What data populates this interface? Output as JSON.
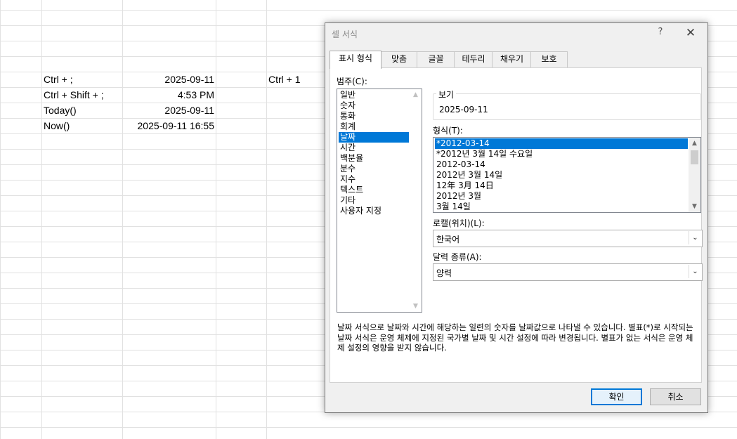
{
  "sheet": {
    "rows": [
      {
        "a": "Ctrl + ;",
        "b": "2025-09-11",
        "c": "Ctrl + 1"
      },
      {
        "a": "Ctrl + Shift + ;",
        "b": "4:53 PM",
        "c": ""
      },
      {
        "a": "Today()",
        "b": "2025-09-11",
        "c": ""
      },
      {
        "a": "Now()",
        "b": "2025-09-11 16:55",
        "c": ""
      }
    ]
  },
  "dialog": {
    "title": "셀 서식",
    "help": "?",
    "close": "✕",
    "tabs": [
      "표시 형식",
      "맞춤",
      "글꼴",
      "테두리",
      "채우기",
      "보호"
    ],
    "category_label": "범주(C):",
    "categories": [
      "일반",
      "숫자",
      "통화",
      "회계",
      "날짜",
      "시간",
      "백분율",
      "분수",
      "지수",
      "텍스트",
      "기타",
      "사용자 지정"
    ],
    "selected_category": "날짜",
    "sample_label": "보기",
    "sample_value": "2025-09-11",
    "type_label": "형식(T):",
    "types": [
      "*2012-03-14",
      "*2012년 3월 14일 수요일",
      "2012-03-14",
      "2012년 3월 14일",
      "12年 3月 14日",
      "2012년 3월",
      "3월 14일"
    ],
    "selected_type": "*2012-03-14",
    "locale_label": "로캘(위치)(L):",
    "locale_value": "한국어",
    "calendar_label": "달력 종류(A):",
    "calendar_value": "양력",
    "description": "날짜 서식으로 날짜와 시간에 해당하는 일련의 숫자를 날짜값으로 나타낼 수 있습니다. 별표(*)로 시작되는 날짜 서식은 운영 체제에 지정된 국가별 날짜 및 시간 설정에 따라 변경됩니다. 별표가 없는 서식은 운영 체제 설정의 영향을 받지 않습니다.",
    "ok_label": "확인",
    "cancel_label": "취소"
  },
  "colors": {
    "selection": "#0078d7",
    "grid": "#e1e1e1",
    "dialog_bg": "#f0f0f0"
  }
}
